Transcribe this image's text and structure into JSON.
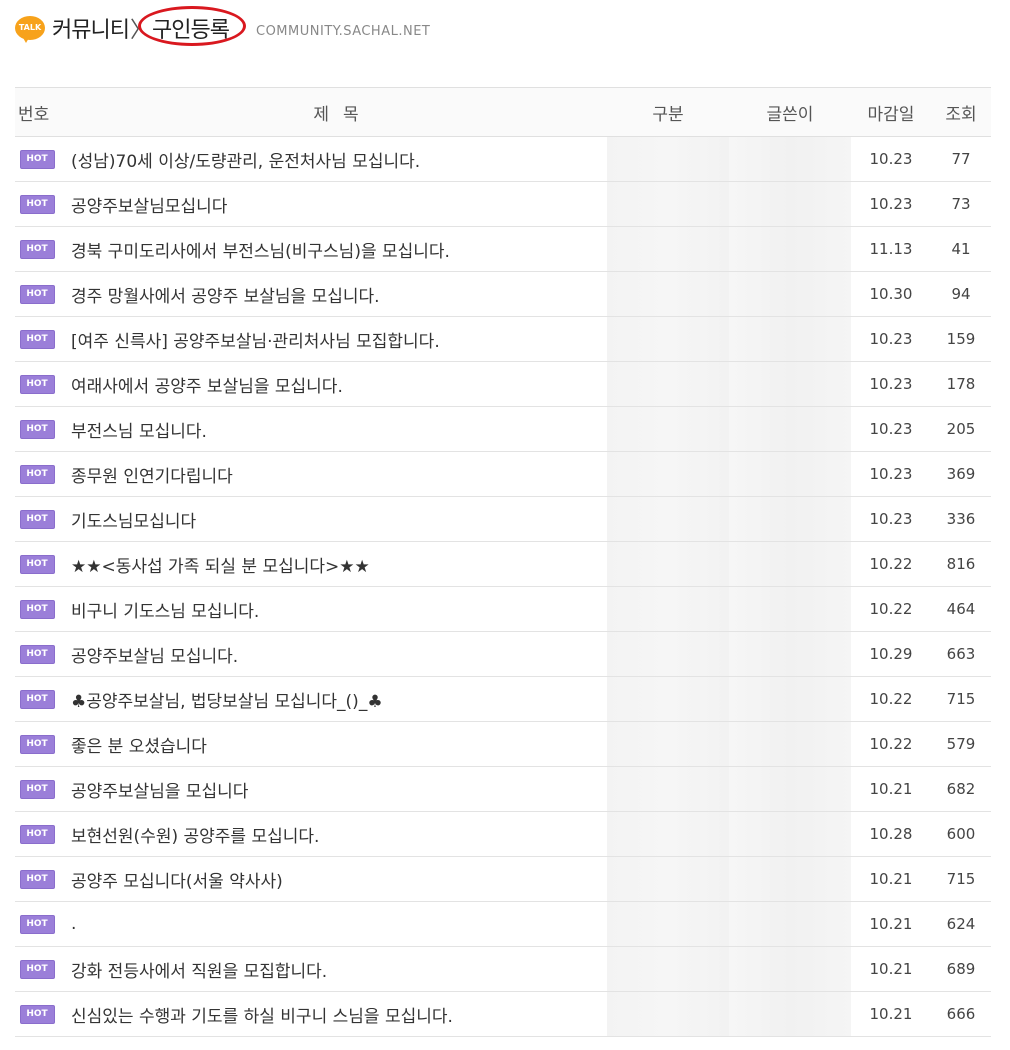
{
  "header": {
    "badge_text": "TALK",
    "brand_first": "커뮤니티",
    "brand_sep": "〉",
    "brand_second": "구인등록",
    "domain": "COMMUNITY.SACHAL.NET",
    "highlight_color": "#d9181f",
    "badge_color": "#f7a21b"
  },
  "table": {
    "columns": {
      "num": "번호",
      "title": "제목",
      "category": "구분",
      "writer": "글쓴이",
      "due": "마감일",
      "views": "조회"
    },
    "hot_label": "HOT",
    "hot_color": "#9b7fd9",
    "rows": [
      {
        "title": "(성남)70세 이상/도량관리, 운전처사님 모십니다.",
        "due": "10.23",
        "views": "77"
      },
      {
        "title": "공양주보살님모십니다",
        "due": "10.23",
        "views": "73"
      },
      {
        "title": "경북 구미도리사에서 부전스님(비구스님)을 모십니다.",
        "due": "11.13",
        "views": "41"
      },
      {
        "title": "경주 망월사에서 공양주 보살님을 모십니다.",
        "due": "10.30",
        "views": "94"
      },
      {
        "title": "[여주 신륵사] 공양주보살님·관리처사님 모집합니다.",
        "due": "10.23",
        "views": "159"
      },
      {
        "title": "여래사에서 공양주 보살님을 모십니다.",
        "due": "10.23",
        "views": "178"
      },
      {
        "title": "부전스님 모십니다.",
        "due": "10.23",
        "views": "205"
      },
      {
        "title": "종무원 인연기다립니다",
        "due": "10.23",
        "views": "369"
      },
      {
        "title": "기도스님모십니다",
        "due": "10.23",
        "views": "336"
      },
      {
        "title": "★★<동사섭 가족 되실 분 모십니다>★★",
        "due": "10.22",
        "views": "816"
      },
      {
        "title": "비구니 기도스님 모십니다.",
        "due": "10.22",
        "views": "464"
      },
      {
        "title": "공양주보살님 모십니다.",
        "due": "10.29",
        "views": "663"
      },
      {
        "title": "♣공양주보살님, 법당보살님 모십니다_()_♣",
        "due": "10.22",
        "views": "715"
      },
      {
        "title": "좋은 분 오셨습니다",
        "due": "10.22",
        "views": "579"
      },
      {
        "title": "공양주보살님을 모십니다",
        "due": "10.21",
        "views": "682"
      },
      {
        "title": "보현선원(수원) 공양주를 모십니다.",
        "due": "10.28",
        "views": "600"
      },
      {
        "title": "공양주 모십니다(서울 약사사)",
        "due": "10.21",
        "views": "715"
      },
      {
        "title": ".",
        "due": "10.21",
        "views": "624"
      },
      {
        "title": "강화 전등사에서 직원을 모집합니다.",
        "due": "10.21",
        "views": "689"
      },
      {
        "title": "신심있는 수행과 기도를 하실 비구니 스님을 모십니다.",
        "due": "10.21",
        "views": "666"
      }
    ]
  }
}
